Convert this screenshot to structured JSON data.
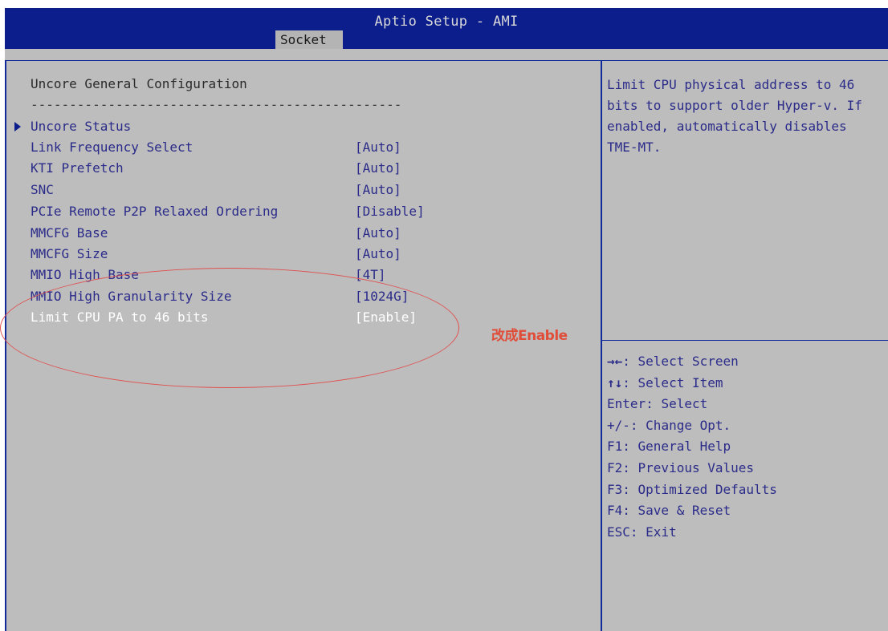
{
  "header": {
    "title": "Aptio Setup - AMI",
    "active_tab": "Socket"
  },
  "main": {
    "section_title": "Uncore General Configuration",
    "separator": "------------------------------------------------",
    "items": [
      {
        "label": "Uncore Status",
        "value": "",
        "type": "submenu"
      },
      {
        "label": "Link Frequency Select",
        "value": "[Auto]"
      },
      {
        "label": "KTI Prefetch",
        "value": "[Auto]"
      },
      {
        "label": "SNC",
        "value": "[Auto]"
      },
      {
        "label": "PCIe Remote P2P Relaxed Ordering",
        "value": "[Disable]"
      },
      {
        "label": "MMCFG Base",
        "value": "[Auto]"
      },
      {
        "label": "MMCFG Size",
        "value": "[Auto]"
      },
      {
        "label": "MMIO High Base",
        "value": "[4T]"
      },
      {
        "label": "MMIO High Granularity Size",
        "value": "[1024G]"
      },
      {
        "label": "Limit CPU PA to 46 bits",
        "value": "[Enable]",
        "selected": true
      }
    ]
  },
  "help": {
    "description": "Limit CPU physical address to 46 bits to support older Hyper-v. If enabled, automatically disables TME-MT."
  },
  "keys": [
    {
      "key": "→←",
      "action": ": Select Screen"
    },
    {
      "key": "↑↓",
      "action": ": Select Item"
    },
    {
      "key": "Enter",
      "action": ": Select"
    },
    {
      "key": "+/-",
      "action": ": Change Opt."
    },
    {
      "key": "F1",
      "action": ": General Help"
    },
    {
      "key": "F2",
      "action": ": Previous Values"
    },
    {
      "key": "F3",
      "action": ": Optimized Defaults"
    },
    {
      "key": "F4",
      "action": ": Save & Reset"
    },
    {
      "key": "ESC",
      "action": ": Exit"
    }
  ],
  "annotation": {
    "text": "改成Enable",
    "color": "#e04d39"
  },
  "colors": {
    "header_bg": "#0c1e8c",
    "body_bg": "#bdbdbd",
    "item_text": "#2b2b8a",
    "selected_text": "#ffffff"
  }
}
